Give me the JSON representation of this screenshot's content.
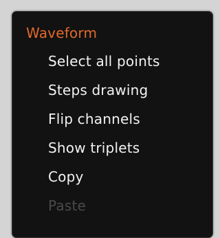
{
  "menu": {
    "header": "Waveform",
    "items": [
      {
        "label": "Select all points",
        "enabled": true
      },
      {
        "label": "Steps drawing",
        "enabled": true
      },
      {
        "label": "Flip channels",
        "enabled": true
      },
      {
        "label": "Show triplets",
        "enabled": true
      },
      {
        "label": "Copy",
        "enabled": true
      },
      {
        "label": "Paste",
        "enabled": false
      }
    ]
  },
  "colors": {
    "header": "#e26a2c",
    "item_enabled": "#f2f2f2",
    "item_disabled": "#4a4a4a",
    "menu_background": "#121212",
    "page_background": "#d4d4d4"
  }
}
